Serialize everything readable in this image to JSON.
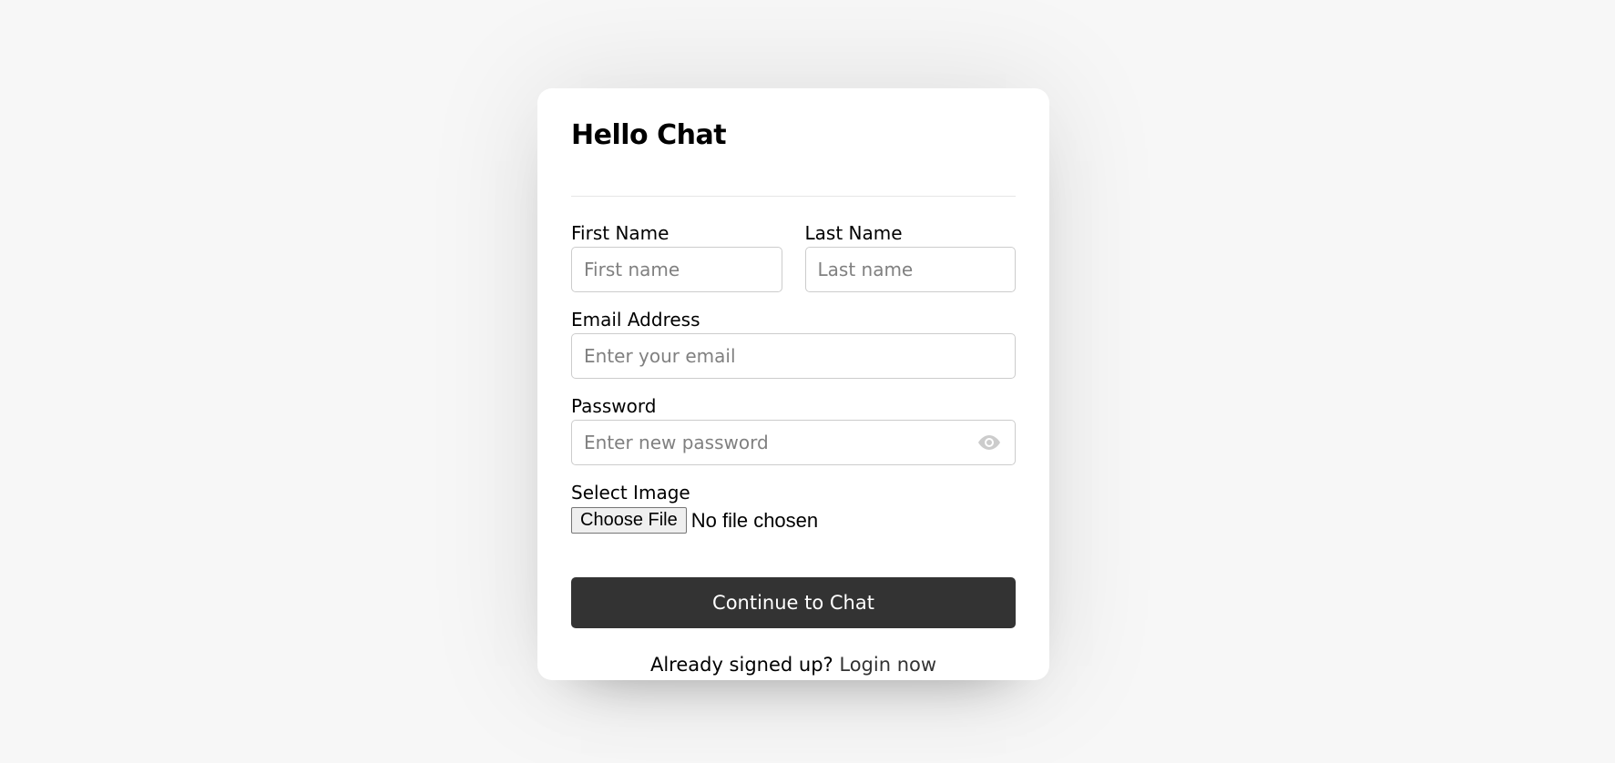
{
  "form": {
    "title": "Hello Chat",
    "first_name": {
      "label": "First Name",
      "placeholder": "First name",
      "value": ""
    },
    "last_name": {
      "label": "Last Name",
      "placeholder": "Last name",
      "value": ""
    },
    "email": {
      "label": "Email Address",
      "placeholder": "Enter your email",
      "value": ""
    },
    "password": {
      "label": "Password",
      "placeholder": "Enter new password",
      "value": "",
      "toggle_icon": "eye-icon"
    },
    "image": {
      "label": "Select Image",
      "button_label": "Choose File",
      "status": "No file chosen"
    },
    "submit_label": "Continue to Chat",
    "footer_text": "Already signed up?",
    "footer_link": "Login now"
  },
  "colors": {
    "page_background": "#f7f7f7",
    "card_background": "#ffffff",
    "button_background": "#333333",
    "button_text": "#ffffff",
    "input_border": "#cccccc",
    "icon_color": "#cccccc"
  }
}
